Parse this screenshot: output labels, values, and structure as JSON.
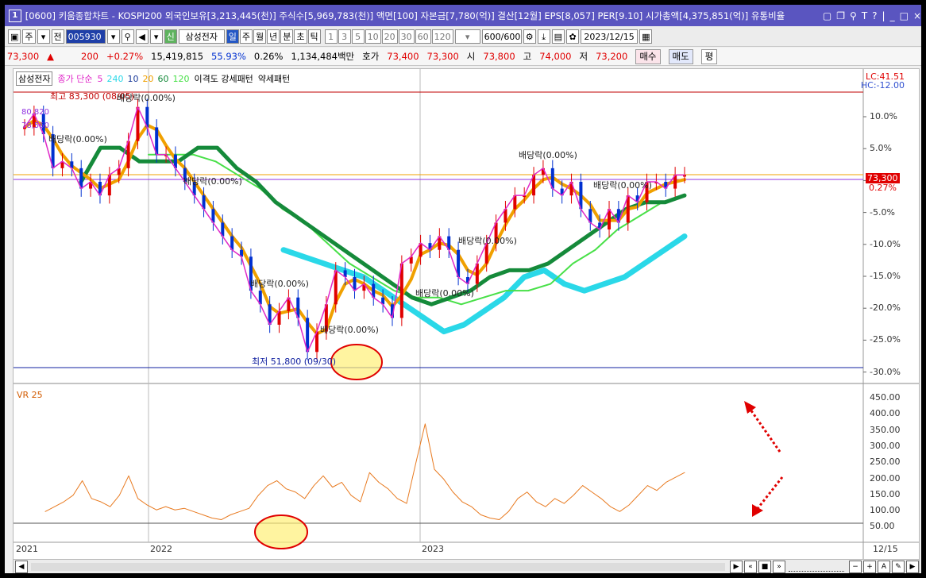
{
  "titlebar": {
    "window_num": "1",
    "title": "[0600] 키움종합차트 - KOSPI200 외국인보유[3,213,445(천)] 주식수[5,969,783(천)] 액면[100] 자본금[7,780(억)] 결산[12월] EPS[8,057] PER[9.10] 시가총액[4,375,851(억)] 유통비율",
    "controls": [
      "▢",
      "❐",
      "⚲",
      "T",
      "?",
      "|",
      "_",
      "□",
      "×"
    ]
  },
  "toolbar": {
    "jutype": "주",
    "prev_label": "전",
    "code": "005930",
    "stock_name": "삼성전자",
    "periods": [
      "일",
      "주",
      "월",
      "년",
      "분",
      "초",
      "틱"
    ],
    "active_period": "일",
    "intervals": [
      "1",
      "3",
      "5",
      "10",
      "20",
      "30",
      "60",
      "120"
    ],
    "count": "600/600",
    "date": "2023/12/15"
  },
  "quote": {
    "price": "73,300",
    "arrow": "▲",
    "change": "200",
    "change_pct": "+0.27%",
    "volume": "15,419,815",
    "vol_ratio": "55.93%",
    "turnover_pct": "0.26%",
    "amount": "1,134,484백만",
    "hoga_label": "호가",
    "ask": "73,400",
    "bid": "73,300",
    "open_label": "시",
    "open": "73,800",
    "high_label": "고",
    "high": "74,000",
    "low_label": "저",
    "low": "73,200",
    "buy_btn": "매수",
    "sell_btn": "매도",
    "eval_btn": "평"
  },
  "legend": {
    "stock": "삼성전자",
    "ma_type": "종가 단순",
    "ma_values": [
      "5",
      "240",
      "10",
      "20",
      "60",
      "120"
    ],
    "ma_colors": [
      "#e028c8",
      "#2ad8e8",
      "#1a3a9a",
      "#f0a000",
      "#158a3a",
      "#48e048"
    ],
    "extra": "이격도 강세패턴",
    "extra2": "약세패턴"
  },
  "price_panel": {
    "lc": "LC:41.51",
    "hc": "HC:-12.00",
    "y_ticks": [
      "10.0%",
      "5.0%",
      "0.0%",
      "-5.0%",
      "-10.0%",
      "-15.0%",
      "-20.0%",
      "-25.0%",
      "-30.0%"
    ],
    "current_tag": "73,300",
    "current_pct": "0.27%",
    "high_label": "최고 83,300 (08/05)",
    "low_label": "최저 51,800 (09/30)",
    "left_values": [
      "80,8",
      "20",
      "78,5",
      "60"
    ],
    "dividend_label": "배당락(0.00%)"
  },
  "vr_panel": {
    "label": "VR 25",
    "y_ticks": [
      "450.00",
      "400.00",
      "350.00",
      "300.00",
      "250.00",
      "200.00",
      "150.00",
      "100.00",
      "50.00"
    ]
  },
  "xaxis": {
    "labels": [
      "2021",
      "2022",
      "2023"
    ],
    "end_label": "12/15"
  },
  "chart_data": {
    "type": "line",
    "price_series_pct": [
      6,
      8,
      5,
      0,
      1,
      0,
      -3,
      -2,
      -4,
      -1,
      0,
      4,
      9,
      6,
      2,
      2,
      0,
      -2,
      -4,
      -6,
      -8,
      -10,
      -12,
      -13,
      -18,
      -20,
      -23,
      -21,
      -19,
      -22,
      -27,
      -24,
      -20,
      -15,
      -16,
      -18,
      -17,
      -19,
      -20,
      -22,
      -14,
      -13,
      -11,
      -12,
      -10,
      -12,
      -16,
      -17,
      -14,
      -11,
      -8,
      -6,
      -4,
      -4,
      -1,
      0,
      -3,
      -4,
      -2,
      -6,
      -8,
      -9,
      -6,
      -8,
      -4,
      -5,
      -2,
      -2,
      -3,
      -1,
      -1
    ],
    "ma60_pct": [
      -2,
      3,
      3,
      1,
      1,
      1,
      3,
      3,
      0,
      -2,
      -5,
      -7,
      -9,
      -11,
      -13,
      -15,
      -17,
      -19,
      -20,
      -19,
      -18,
      -16,
      -15,
      -15,
      -14,
      -12,
      -10,
      -8,
      -6,
      -5,
      -5,
      -4
    ],
    "ma120_pct": [
      2,
      2,
      2,
      1,
      -1,
      -3,
      -6,
      -8,
      -11,
      -14,
      -16,
      -18,
      -19,
      -19,
      -20,
      -19,
      -18,
      -18,
      -17,
      -14,
      -12,
      -9,
      -7,
      -5,
      -4
    ],
    "ma240_pct": [
      -12,
      -13,
      -14,
      -15,
      -16,
      -18,
      -20,
      -22,
      -24,
      -23,
      -21,
      -19,
      -16,
      -15,
      -17,
      -18,
      -17,
      -16,
      -14,
      -12,
      -10
    ],
    "vr_values": [
      80,
      95,
      110,
      130,
      175,
      120,
      110,
      95,
      130,
      190,
      120,
      100,
      85,
      95,
      85,
      90,
      80,
      70,
      60,
      55,
      70,
      80,
      90,
      130,
      160,
      175,
      150,
      140,
      120,
      160,
      190,
      155,
      170,
      130,
      110,
      200,
      170,
      150,
      120,
      105,
      230,
      350,
      210,
      180,
      140,
      110,
      95,
      70,
      60,
      55,
      80,
      120,
      140,
      110,
      95,
      120,
      105,
      130,
      160,
      140,
      120,
      95,
      80,
      100,
      130,
      160,
      145,
      170,
      185,
      200
    ],
    "y_range_pct": [
      -30,
      12
    ],
    "vr_range": [
      0,
      450
    ]
  }
}
